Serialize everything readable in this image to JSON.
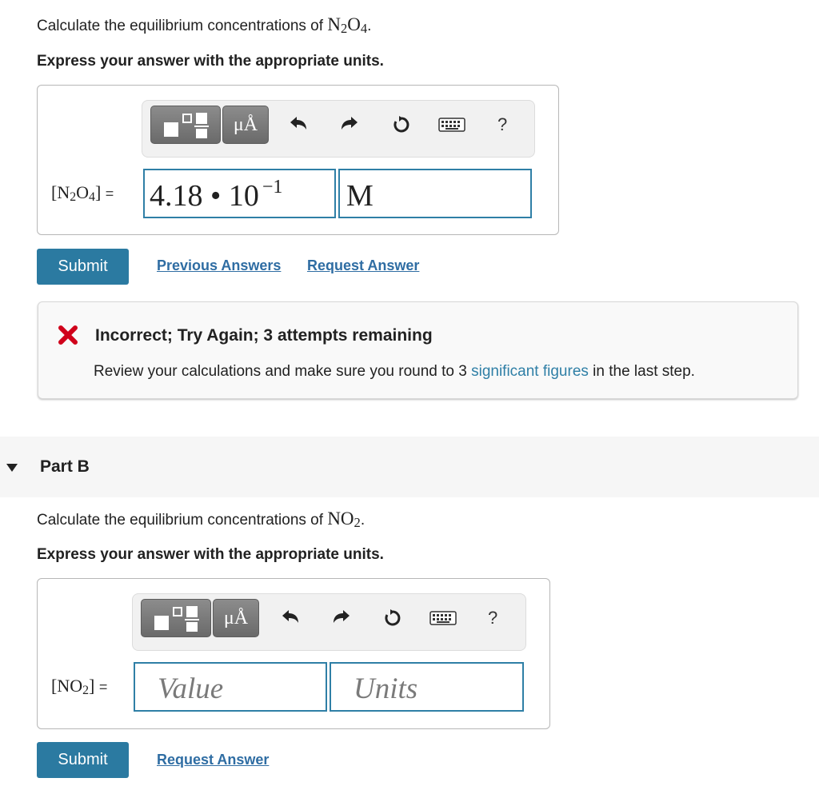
{
  "part_a": {
    "question_prefix": "Calculate the equilibrium concentrations of ",
    "question_species": "N2O4",
    "instruction": "Express your answer with the appropriate units.",
    "toolbar": {
      "units_label": "μÅ",
      "help_label": "?"
    },
    "answer_label": "[N2O4]",
    "equals": "=",
    "value_mantissa": "4.18",
    "value_dot": "•",
    "value_base": "10",
    "value_exponent": "−1",
    "units_value": "M",
    "submit_label": "Submit",
    "previous_answers_label": "Previous Answers",
    "request_answer_label": "Request Answer",
    "feedback": {
      "title": "Incorrect; Try Again; 3 attempts remaining",
      "message_prefix": "Review your calculations and make sure you round to 3 ",
      "message_link": "significant figures",
      "message_suffix": " in the last step."
    }
  },
  "part_b": {
    "title": "Part B",
    "question_prefix": "Calculate the equilibrium concentrations of ",
    "question_species": "NO2",
    "instruction": "Express your answer with the appropriate units.",
    "toolbar": {
      "units_label": "μÅ",
      "help_label": "?"
    },
    "answer_label": "[NO2]",
    "equals": "=",
    "value_placeholder": "Value",
    "units_placeholder": "Units",
    "submit_label": "Submit",
    "request_answer_label": "Request Answer"
  },
  "colors": {
    "accent": "#2b7aa1",
    "link": "#2f6da3",
    "field_border": "#2f7fa6",
    "error_x": "#d0021b"
  }
}
